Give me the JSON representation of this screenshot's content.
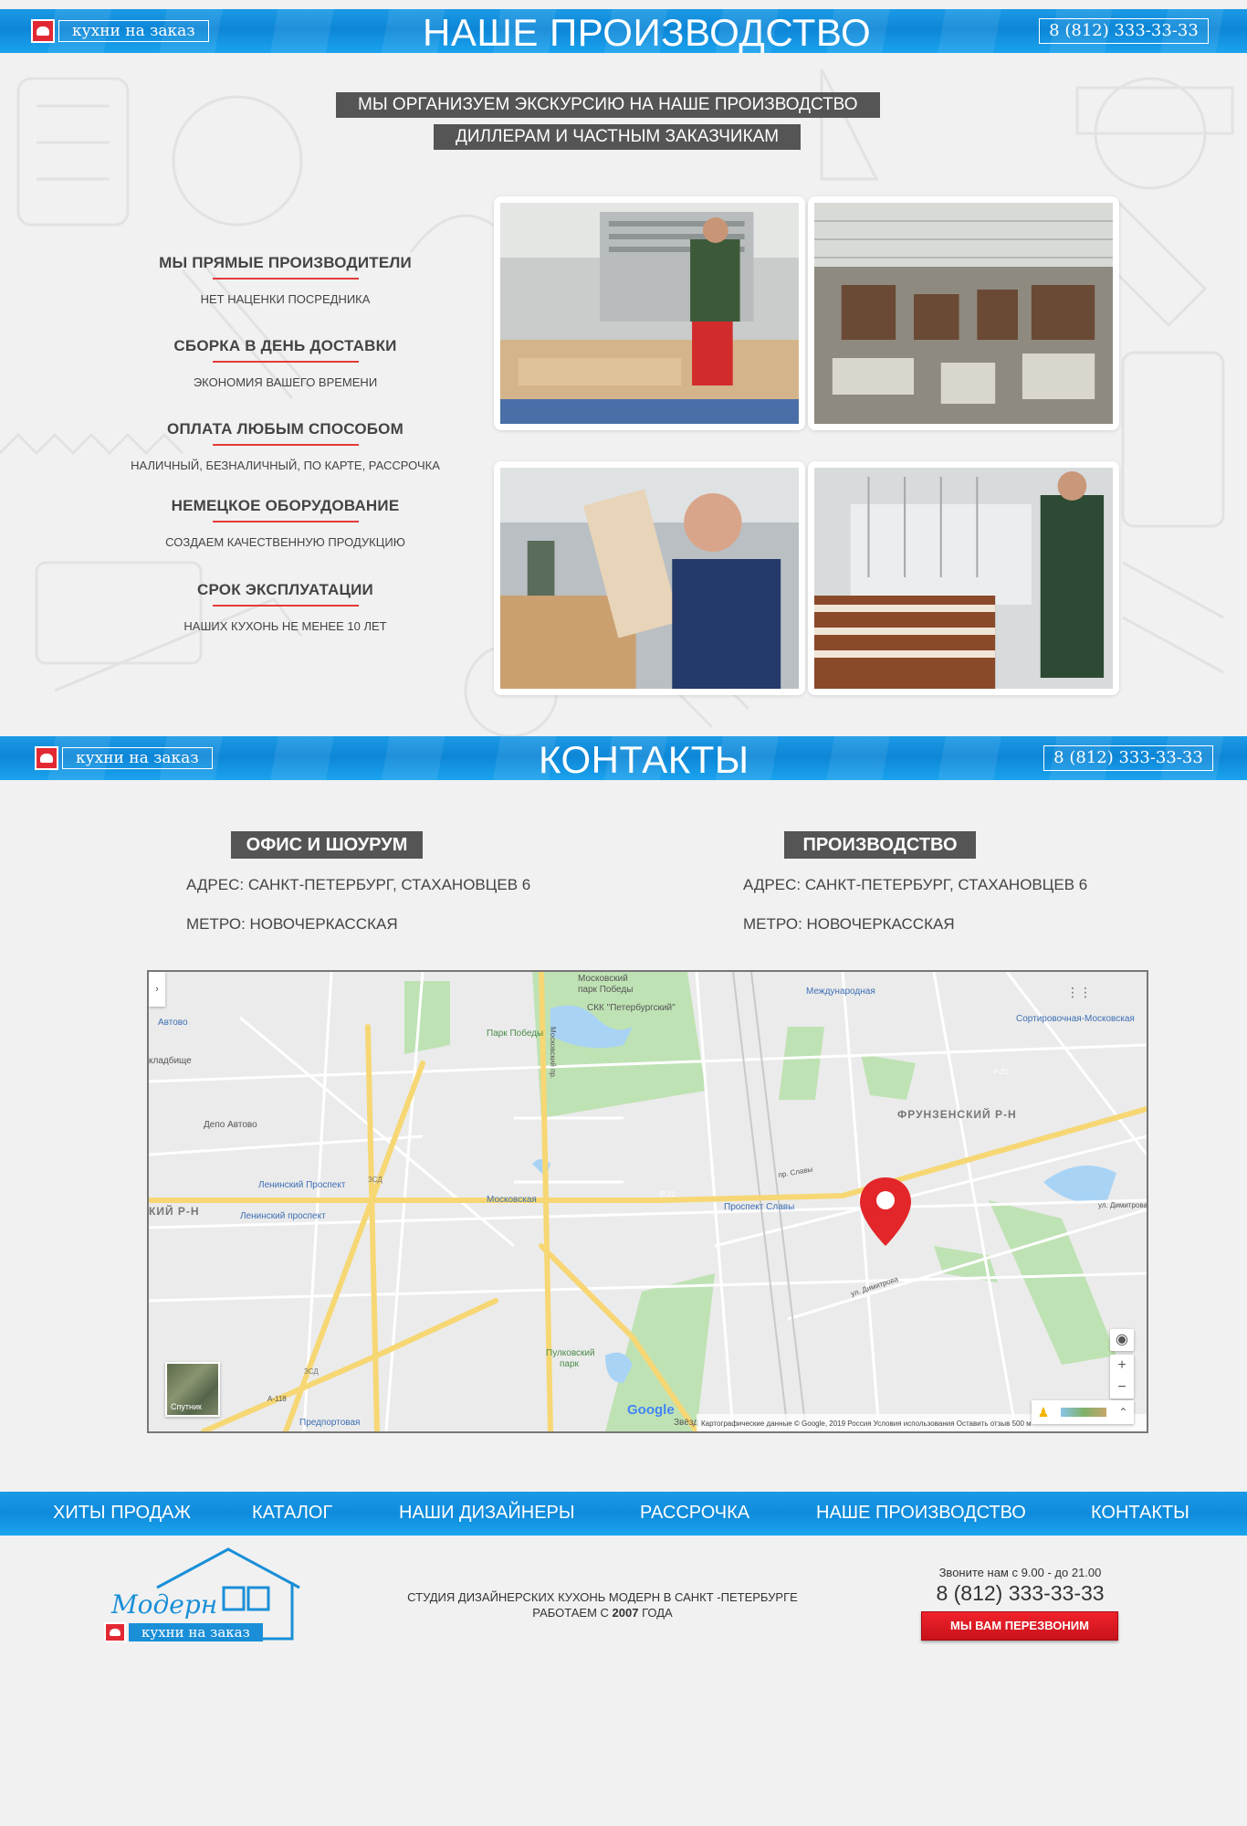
{
  "header_production": {
    "logo_text": "кухни на заказ",
    "title": "НАШЕ ПРОИЗВОДСТВО",
    "phone": "8 (812) 333-33-33"
  },
  "tour": {
    "line1": "МЫ ОРГАНИЗУЕМ ЭКСКУРСИЮ НА НАШЕ ПРОИЗВОДСТВО",
    "line2": "ДИЛЛЕРАМ И ЧАСТНЫМ ЗАКАЗЧИКАМ"
  },
  "features": [
    {
      "title": "МЫ ПРЯМЫЕ ПРОИЗВОДИТЕЛИ",
      "desc": "НЕТ НАЦЕНКИ ПОСРЕДНИКА"
    },
    {
      "title": "СБОРКА В ДЕНЬ ДОСТАВКИ",
      "desc": "ЭКОНОМИЯ ВАШЕГО ВРЕМЕНИ"
    },
    {
      "title": "ОПЛАТА ЛЮБЫМ СПОСОБОМ",
      "desc": "НАЛИЧНЫЙ, БЕЗНАЛИЧНЫЙ, ПО КАРТЕ, РАССРОЧКА"
    },
    {
      "title": "НЕМЕЦКОЕ ОБОРУДОВАНИЕ",
      "desc": "СОЗДАЕМ КАЧЕСТВЕННУЮ ПРОДУКЦИЮ"
    },
    {
      "title": "СРОК ЭКСПЛУАТАЦИИ",
      "desc": "НАШИХ КУХОНЬ НЕ МЕНЕЕ 10 ЛЕТ"
    }
  ],
  "header_contacts": {
    "logo_text": "кухни на заказ",
    "title": "КОНТАКТЫ",
    "phone": "8 (812) 333-33-33"
  },
  "contacts": {
    "office": {
      "label": "ОФИС И ШОУРУМ",
      "address": "АДРЕС: САНКТ-ПЕТЕРБУРГ, СТАХАНОВЦЕВ 6",
      "metro": "МЕТРО: НОВОЧЕРКАССКАЯ"
    },
    "production": {
      "label": "ПРОИЗВОДСТВО",
      "address": "АДРЕС: САНКТ-ПЕТЕРБУРГ, СТАХАНОВЦЕВ 6",
      "metro": "МЕТРО: НОВОЧЕРКАССКАЯ"
    }
  },
  "map": {
    "labels": {
      "park_pobedy_top": "Московский",
      "park_pobedy_top2": "парк Победы",
      "skk": "СКК \"Петербургский\"",
      "park_pobedy": "Парк Победы",
      "mezhdunarodnaya": "Международная",
      "sortirovochnaya": "Сортировочная-Московская",
      "avtovo": "Автово",
      "kladbische": "кладбище",
      "depo": "Депо Автово",
      "frunzensky": "ФРУНЗЕНСКИЙ Р-Н",
      "leninsky1": "Ленинский Проспект",
      "leninsky2": "Ленинский проспект",
      "kiy_rn": "КИЙ Р-Н",
      "moskovskaya": "Московская",
      "prospekt_slavy": "Проспект Славы",
      "pulkovsky1": "Пулковский",
      "pulkovsky2": "парк",
      "predportovaya": "Предпортовая",
      "zvezd": "Звёзд",
      "r21a": "Р-21",
      "r21b": "Р-21",
      "a118": "А-118",
      "zsd1": "ЗСД",
      "zsd2": "ЗСД",
      "moskovsky_pr": "Московский пр.",
      "pr_slavy": "пр. Славы",
      "ul_dimitrova": "ул. Димитрова",
      "ul_dimitrova2": "ул. Димитрова"
    },
    "satellite": "Спутник",
    "google": "Google",
    "attribution": "Картографические данные © Google, 2019    Россия    Условия использования    Оставить отзыв    500 м",
    "zoom_in": "+",
    "zoom_out": "−",
    "expand": "›"
  },
  "nav": [
    "ХИТЫ ПРОДАЖ",
    "КАТАЛОГ",
    "НАШИ ДИЗАЙНЕРЫ",
    "РАССРОЧКА",
    "НАШЕ ПРОИЗВОДСТВО",
    "КОНТАКТЫ"
  ],
  "footer": {
    "brand_script": "Модерн",
    "brand_tag": "кухни на заказ",
    "studio_line": "СТУДИЯ ДИЗАЙНЕРСКИХ КУХОНЬ МОДЕРН В САНКТ -ПЕТЕРБУРГЕ",
    "since_prefix": "РАБОТАЕМ С ",
    "since_year": "2007",
    "since_suffix": " ГОДА",
    "hours": "Звоните нам с 9.00 - до 21.00",
    "phone": "8 (812) 333-33-33",
    "callback": "МЫ ВАМ ПЕРЕЗВОНИМ"
  },
  "colors": {
    "bar_blue": "#0d86d6",
    "label_grey": "#555555",
    "accent_red": "#e53a3a",
    "pin_red": "#e2262a"
  }
}
